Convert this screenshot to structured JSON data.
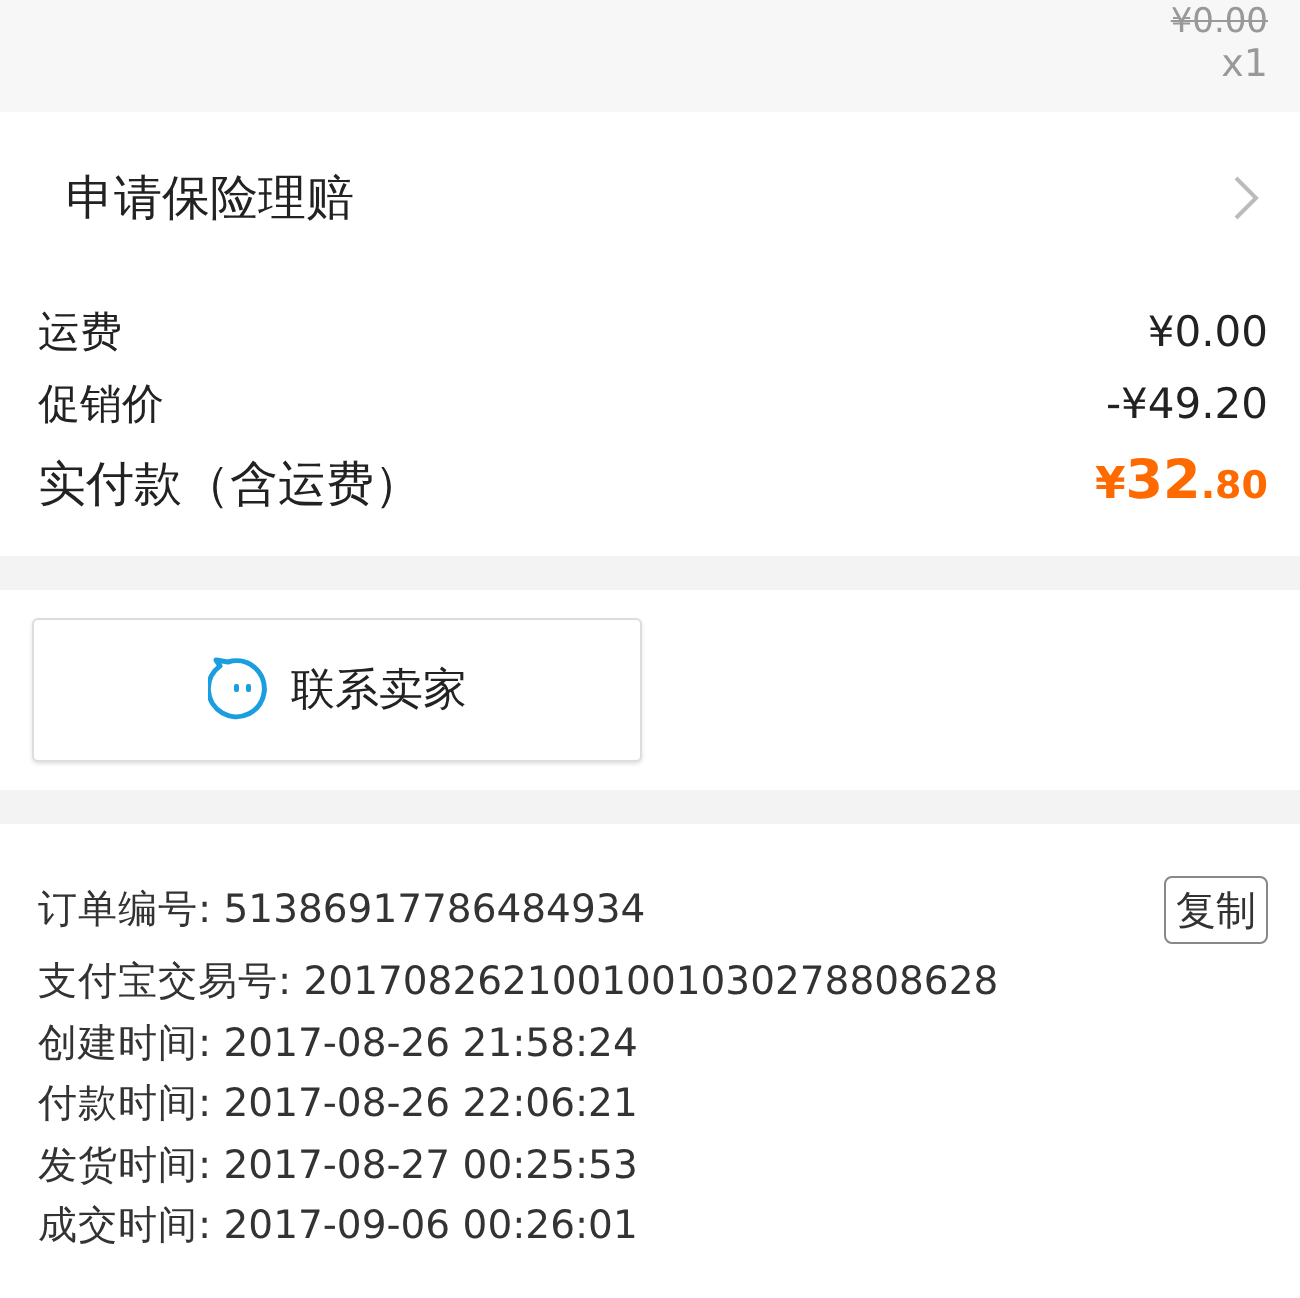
{
  "item": {
    "original_price": "¥0.00",
    "quantity": "x1"
  },
  "insurance_claim": {
    "label": "申请保险理赔"
  },
  "fees": [
    {
      "kind": "normal",
      "label": "运费",
      "value": "¥0.00"
    },
    {
      "kind": "normal",
      "label": "促销价",
      "value": "-¥49.20"
    },
    {
      "kind": "total",
      "label": "实付款（含运费）",
      "currency": "¥",
      "integer": "32",
      "decimal": ".80"
    }
  ],
  "contact_button": {
    "label": "联系卖家"
  },
  "order_info": {
    "copy_button": "复制",
    "lines": [
      {
        "label": "订单编号:",
        "value": "51386917786484934"
      },
      {
        "label": "支付宝交易号:",
        "value": "2017082621001001030278808628"
      },
      {
        "label": "创建时间:",
        "value": "2017-08-26 21:58:24"
      },
      {
        "label": "付款时间:",
        "value": "2017-08-26 22:06:21"
      },
      {
        "label": "发货时间:",
        "value": "2017-08-27 00:25:53"
      },
      {
        "label": "成交时间:",
        "value": "2017-09-06 00:26:01"
      }
    ]
  }
}
